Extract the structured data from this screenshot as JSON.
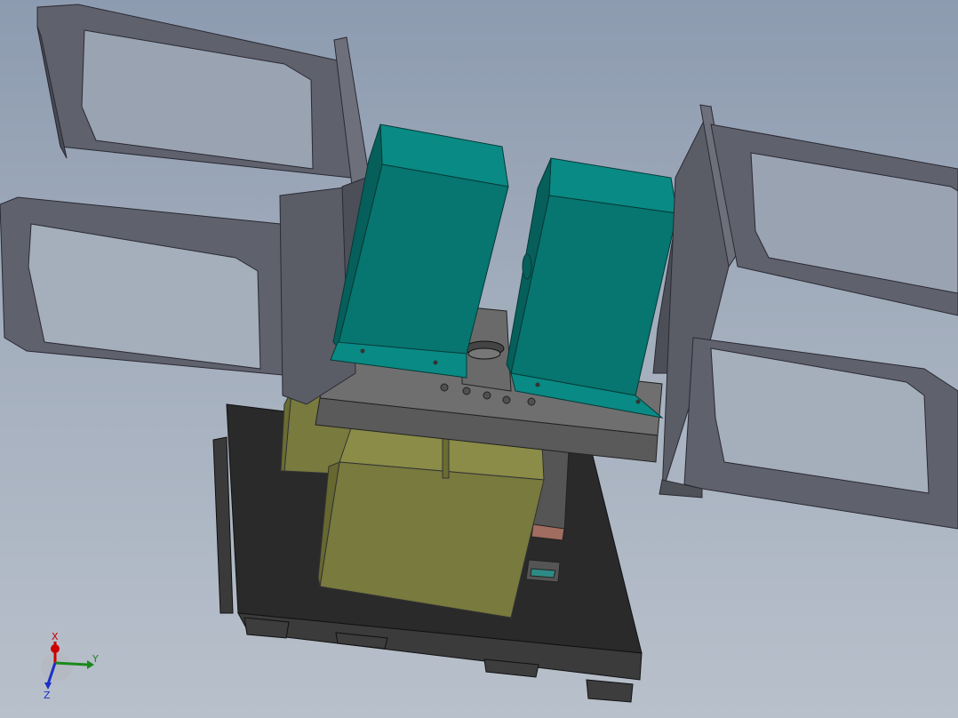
{
  "viewport": {
    "background_top": "#8d9bb0",
    "background_bottom": "#b8c0cb"
  },
  "model": {
    "frame_color": "#5f616c",
    "clamp_block_color": "#087873",
    "base_block_color": "#787a3e",
    "base_plate_color": "#2a2a2a",
    "turntable_color": "#a06d60"
  },
  "triad": {
    "x_label": "X",
    "y_label": "Y",
    "z_label": "Z",
    "x_color": "#cc0000",
    "y_color": "#1a8a1a",
    "z_color": "#1a2fcc"
  }
}
